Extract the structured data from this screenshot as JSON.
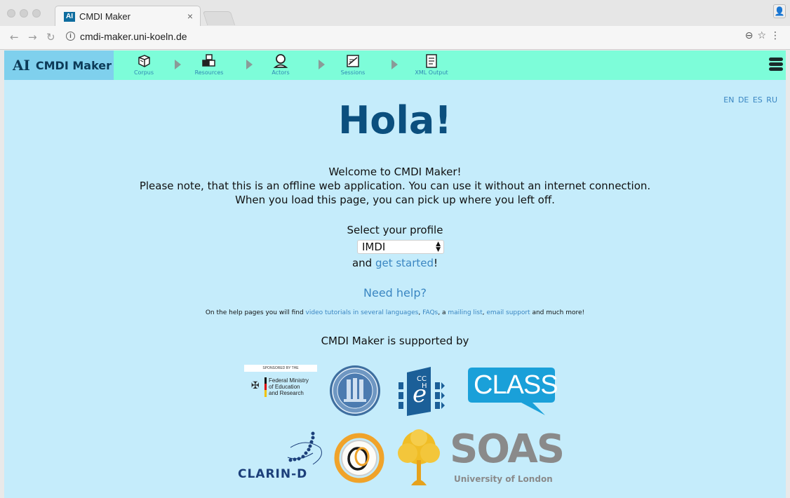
{
  "browser": {
    "tab_title": "CMDI Maker",
    "tab_favicon": "AI",
    "url": "cmdi-maker.uni-koeln.de",
    "url_info_icon": "info-icon"
  },
  "app": {
    "brand_logo": "AI",
    "brand_name": "CMDI Maker",
    "steps": [
      {
        "label": "Corpus",
        "icon": "corpus-icon"
      },
      {
        "label": "Resources",
        "icon": "resources-icon"
      },
      {
        "label": "Actors",
        "icon": "actors-icon"
      },
      {
        "label": "Sessions",
        "icon": "sessions-icon"
      },
      {
        "label": "XML Output",
        "icon": "xml-output-icon"
      }
    ],
    "menu_icon": "hamburger-icon",
    "colors": {
      "topbar": "#7dfdd9",
      "brand": "#7fd0ed",
      "page": "#c5ecfb",
      "heading": "#0b4f7e",
      "link": "#3a86c2"
    }
  },
  "languages": [
    "EN",
    "DE",
    "ES",
    "RU"
  ],
  "content": {
    "greeting": "Hola!",
    "welcome_lines": [
      "Welcome to CMDI Maker!",
      "Please note, that this is an offline web application. You can use it without an internet connection.",
      "When you load this page, you can pick up where you left off."
    ],
    "select_label": "Select your profile",
    "profile_selected": "IMDI",
    "started_prefix": "and ",
    "started_link": "get started",
    "started_suffix": "!",
    "need_help": "Need help?",
    "help_prefix": "On the help pages you will find ",
    "help_link_videos": "video tutorials in several languages",
    "help_sep1": ", ",
    "help_link_faqs": "FAQs",
    "help_sep2": ", a ",
    "help_link_mailing": "mailing list",
    "help_sep3": ", ",
    "help_link_email": "email support",
    "help_suffix": " and much more!",
    "supported_by": "CMDI Maker is supported by"
  },
  "sponsors": {
    "bmbf_sponsored": "SPONSORED BY THE",
    "bmbf_line1": "Federal Ministry",
    "bmbf_line2": "of Education",
    "bmbf_line3": "and Research",
    "cceh_letters": "C C e H",
    "class": "CLASS",
    "clarin": "CLARIN-D",
    "soas": "SOAS",
    "soas_sub": "University of London"
  }
}
